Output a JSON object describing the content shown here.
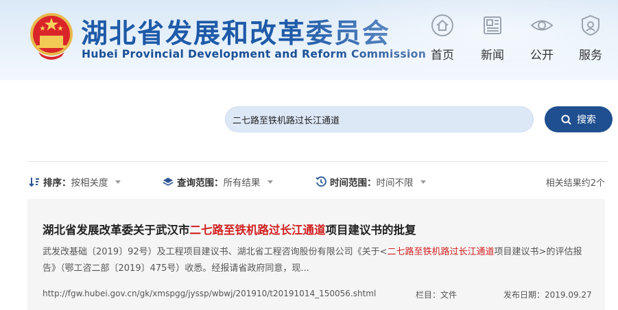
{
  "header": {
    "title": "湖北省发展和改革委员会",
    "subtitle": "Hubei Provincial Development and Reform Commission",
    "nav": [
      {
        "label": "首页",
        "icon": "home-icon"
      },
      {
        "label": "新闻",
        "icon": "news-icon"
      },
      {
        "label": "公开",
        "icon": "eye-icon"
      },
      {
        "label": "服务",
        "icon": "service-icon"
      }
    ]
  },
  "search": {
    "query": "二七路至铁机路过长江通道",
    "button_label": "搜索"
  },
  "filters": {
    "sort": {
      "label": "排序：",
      "value": "按相关度"
    },
    "scope": {
      "label": "查询范围：",
      "value": "所有结果"
    },
    "time": {
      "label": "时间范围：",
      "value": "时间不限"
    },
    "result_count": "相关结果约2个"
  },
  "result": {
    "title_prefix": "湖北省发展改革委关于武汉市",
    "title_highlight": "二七路至铁机路过长江通道",
    "title_suffix": "项目建议书的批复",
    "snippet_part1": "武发改基础〔2019〕92号）及工程项目建议书、湖北省工程咨询股份有限公司《关于<",
    "snippet_highlight": "二七路至铁机路过长江通道",
    "snippet_part2": "项目建议书>的评估报告》（鄂工咨二部〔2019〕475号）收悉。经报请省政府同意，现...",
    "url": "http://fgw.hubei.gov.cn/gk/xmspgg/jyssp/wbwj/201910/t20191014_150056.shtml",
    "column": "栏目：文件",
    "date": "发布日期：2019.09.27"
  },
  "colors": {
    "brand_blue": "#1e5aa8",
    "button_blue": "#1f4f8f",
    "highlight_red": "#d22020"
  }
}
